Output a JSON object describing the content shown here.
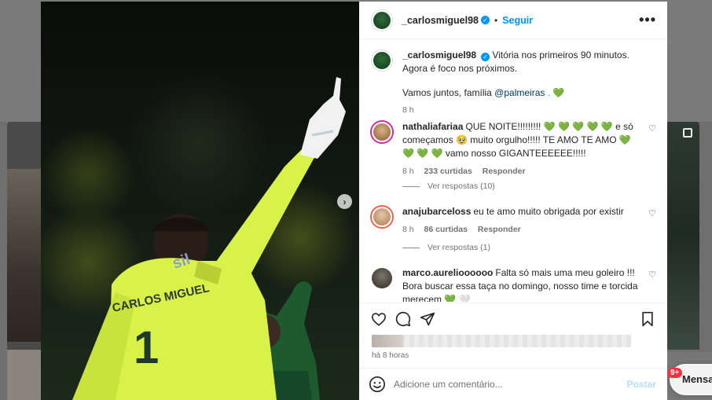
{
  "post": {
    "author": "_carlosmiguel98",
    "follow_label": "Seguir",
    "caption_line1": "Vitória nos primeiros 90 minutos. Agora é foco nos próximos.",
    "caption_line2_prefix": "Vamos juntos, família",
    "caption_mention": "@palmeiras",
    "caption_line2_suffix": ". 💚",
    "caption_time": "8 h",
    "time_ago": "há 8 horas",
    "more_icon": "more-horizontal-icon",
    "next_icon": "chevron-right-icon"
  },
  "comments": [
    {
      "user": "nathaliafariaa",
      "text": "QUE NOITE!!!!!!!!! 💚 💚 💚 💚 💚 e só começamos 🥹 muito orgulho!!!!! TE AMO TE AMO 💚 💚 💚 💚 vamo nosso GIGANTEEEEEE!!!!!",
      "time": "8 h",
      "likes": "233 curtidas",
      "reply": "Responder",
      "view_replies": "Ver respostas (10)"
    },
    {
      "user": "anajubarceloss",
      "text": "eu te amo muito obrigada por existir",
      "time": "8 h",
      "likes": "86 curtidas",
      "reply": "Responder",
      "view_replies": "Ver respostas (1)"
    },
    {
      "user": "marco.aurelioooooo",
      "text": "Falta só mais uma meu goleiro !!! Bora buscar essa taça no domingo, nosso time e torcida merecem 💚 🤍"
    }
  ],
  "actions": {
    "like_icon": "heart-icon",
    "comment_icon": "comment-icon",
    "share_icon": "send-icon",
    "save_icon": "bookmark-icon"
  },
  "comment_box": {
    "placeholder": "Adicione um comentário...",
    "post_label": "Postar",
    "emoji_icon": "emoji-icon"
  },
  "photo": {
    "jersey_name": "CARLOS MIGUEL",
    "jersey_number": "1",
    "sponsor": "sil"
  },
  "messages": {
    "badge": "9+",
    "label": "Mensa"
  },
  "colors": {
    "accent": "#0095f6",
    "jersey": "#d9f24a",
    "palmeiras_green": "#1f6b35"
  }
}
